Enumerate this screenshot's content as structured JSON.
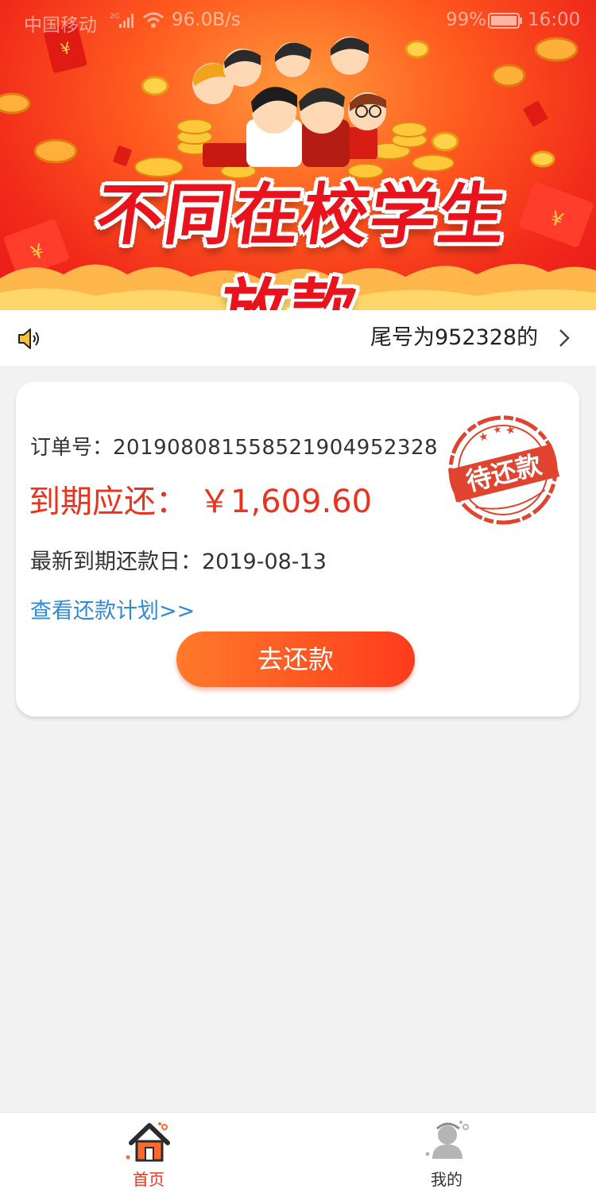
{
  "status_bar": {
    "carrier": "中国移动",
    "network_badge": "2G",
    "speed": "96.0B/s",
    "battery": "99%",
    "time": "16:00"
  },
  "banner": {
    "title": "不同在校学生放款"
  },
  "notice": {
    "text": "尾号为952328的"
  },
  "order": {
    "order_label": "订单号：",
    "order_number": "20190808155852190495232​8",
    "due_label": "到期应还：",
    "due_amount": "￥1,609.60",
    "date_label": "最新到期还款日：",
    "due_date": "2019-08-13",
    "plan_link": "查看还款计划>>",
    "pay_button": "去还款",
    "stamp_text": "待还款"
  },
  "bottom_nav": {
    "items": [
      {
        "label": "首页",
        "icon": "home-icon",
        "active": true
      },
      {
        "label": "我的",
        "icon": "user-icon",
        "active": false
      }
    ]
  },
  "colors": {
    "accent": "#e8331e",
    "link": "#2f8bd8",
    "button_start": "#ff7a2a",
    "button_end": "#ff3b1c"
  }
}
